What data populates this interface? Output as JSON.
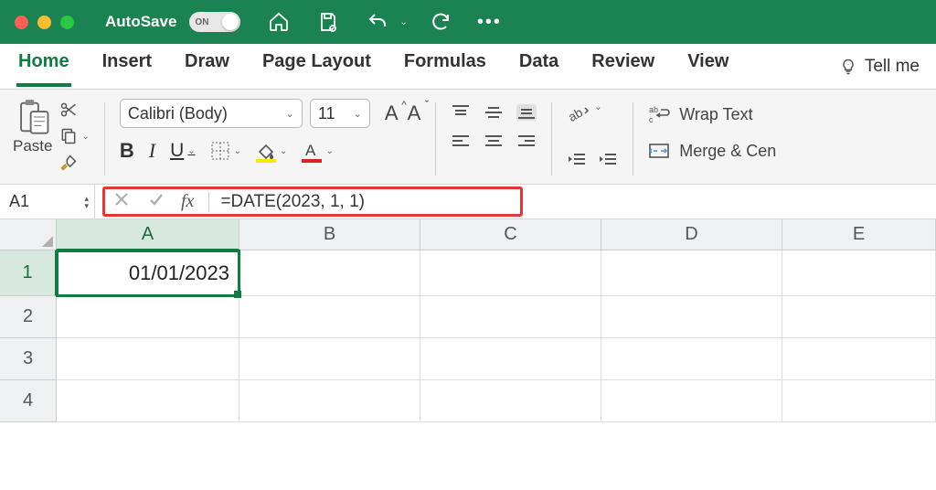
{
  "titlebar": {
    "autosave_label": "AutoSave",
    "autosave_state": "ON"
  },
  "tabs": {
    "home": "Home",
    "insert": "Insert",
    "draw": "Draw",
    "page_layout": "Page Layout",
    "formulas": "Formulas",
    "data": "Data",
    "review": "Review",
    "view": "View",
    "tell_me": "Tell me"
  },
  "ribbon": {
    "paste": "Paste",
    "font_name": "Calibri (Body)",
    "font_size": "11",
    "bold": "B",
    "italic": "I",
    "underline": "U",
    "wrap_text": "Wrap Text",
    "merge_center": "Merge & Cen"
  },
  "formula_bar": {
    "name_box": "A1",
    "fx_label": "fx",
    "formula": "=DATE(2023, 1, 1)"
  },
  "sheet": {
    "columns": [
      "A",
      "B",
      "C",
      "D",
      "E"
    ],
    "rows": [
      "1",
      "2",
      "3",
      "4"
    ],
    "cell_A1": "01/01/2023"
  }
}
